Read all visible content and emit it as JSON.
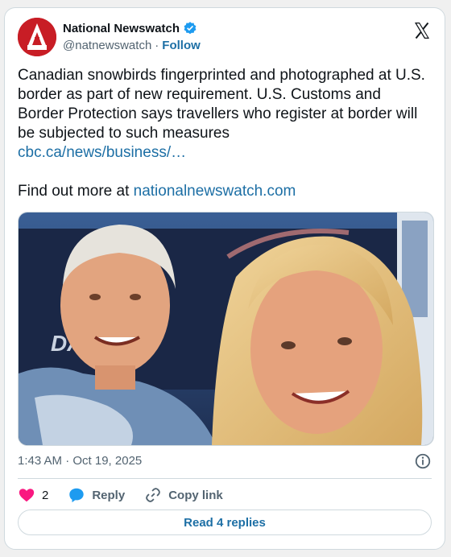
{
  "tweet": {
    "author_name": "National Newswatch",
    "handle": "@natnewswatch",
    "separator": "·",
    "follow_label": "Follow",
    "text_main": "Canadian snowbirds fingerprinted and photographed at U.S. border as part of new requirement. U.S. Customs and Border Protection says travellers who register at border will be subjected to such measures",
    "link": "cbc.ca/news/business/…",
    "more_prefix": "Find out more at ",
    "more_link": "nationalnewswatch.com",
    "photo_truck_text": "DAD",
    "timestamp": "1:43 AM · Oct 19, 2025"
  },
  "actions": {
    "like_count": "2",
    "reply_label": "Reply",
    "copy_label": "Copy link",
    "read_replies_label": "Read 4 replies"
  },
  "colors": {
    "link": "#1d6fa5",
    "verified": "#1d9bf0",
    "heart": "#f91880",
    "avatar": "#c81d25"
  },
  "icons": [
    "avatar-logo",
    "verified-badge-icon",
    "x-logo-icon",
    "info-icon",
    "heart-icon",
    "reply-bubble-icon",
    "link-icon"
  ]
}
